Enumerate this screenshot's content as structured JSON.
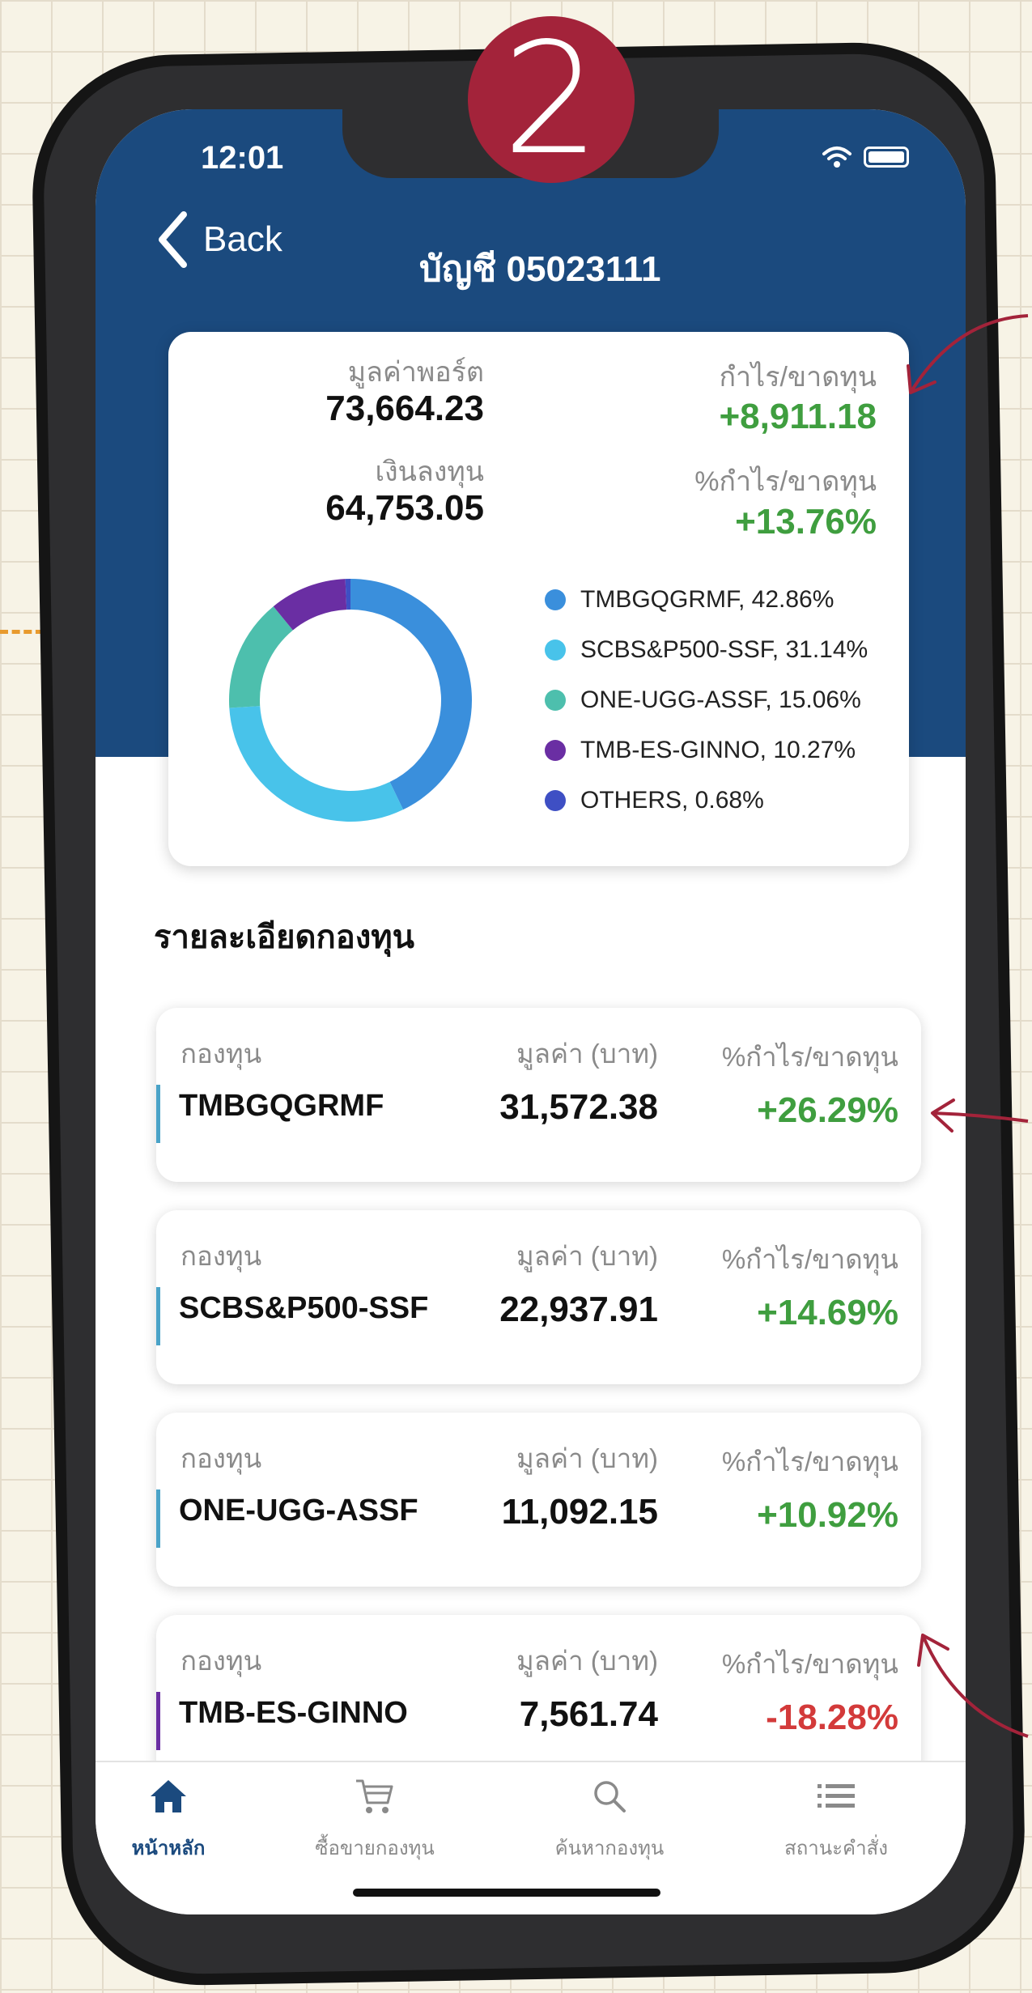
{
  "step_badge": "2",
  "status_bar": {
    "time": "12:01"
  },
  "header": {
    "back_label": "Back",
    "title": "บัญชี 05023111"
  },
  "summary": {
    "portfolio_value_label": "มูลค่าพอร์ต",
    "portfolio_value": "73,664.23",
    "profit_loss_label": "กำไร/ขาดทุน",
    "profit_loss": "+8,911.18",
    "investment_label": "เงินลงทุน",
    "investment": "64,753.05",
    "profit_loss_pct_label": "%กำไร/ขาดทุน",
    "profit_loss_pct": "+13.76%"
  },
  "allocation": [
    {
      "label": "TMBGQGRMF, 42.86%",
      "percent": 42.86,
      "color": "#3a8fdc"
    },
    {
      "label": "SCBS&P500-SSF, 31.14%",
      "percent": 31.14,
      "color": "#48c3ea"
    },
    {
      "label": "ONE-UGG-ASSF, 15.06%",
      "percent": 15.06,
      "color": "#4dbfad"
    },
    {
      "label": "TMB-ES-GINNO, 10.27%",
      "percent": 10.27,
      "color": "#6a2ea3"
    },
    {
      "label": "OTHERS, 0.68%",
      "percent": 0.68,
      "color": "#3e4fc4"
    }
  ],
  "section_title": "รายละเอียดกองทุน",
  "fund_headers": {
    "fund": "กองทุน",
    "value": "มูลค่า (บาท)",
    "pct": "%กำไร/ขาดทุน"
  },
  "funds": [
    {
      "name": "TMBGQGRMF",
      "value": "31,572.38",
      "pct": "+26.29%",
      "pct_color": "#3f9e3f",
      "bar_color": "#4aa3c8"
    },
    {
      "name": "SCBS&P500-SSF",
      "value": "22,937.91",
      "pct": "+14.69%",
      "pct_color": "#3f9e3f",
      "bar_color": "#4aa3c8"
    },
    {
      "name": "ONE-UGG-ASSF",
      "value": "11,092.15",
      "pct": "+10.92%",
      "pct_color": "#3f9e3f",
      "bar_color": "#4aa3c8"
    },
    {
      "name": "TMB-ES-GINNO",
      "value": "7,561.74",
      "pct": "-18.28%",
      "pct_color": "#d33a3a",
      "bar_color": "#6a2ea3"
    }
  ],
  "tabs": [
    {
      "label": "หน้าหลัก",
      "icon": "home-icon",
      "active": true
    },
    {
      "label": "ซื้อขายกองทุน",
      "icon": "cart-icon",
      "active": false
    },
    {
      "label": "ค้นหากองทุน",
      "icon": "search-icon",
      "active": false
    },
    {
      "label": "สถานะคำสั่ง",
      "icon": "list-icon",
      "active": false
    }
  ],
  "colors": {
    "header_blue": "#1b4a7e",
    "positive_green": "#3f9e3f",
    "negative_red": "#d33a3a",
    "badge_red": "#a3233a",
    "annotation_orange": "#e89a2e"
  }
}
